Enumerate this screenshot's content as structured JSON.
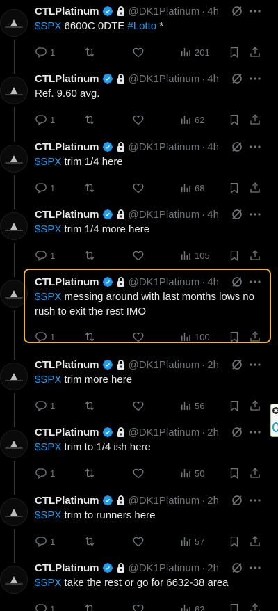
{
  "colors": {
    "background": "#000000",
    "text": "#e7e9ea",
    "muted": "#71767b",
    "link": "#1d9bf0",
    "verified": "#1d9bf0",
    "highlight": "#f2b630"
  },
  "icons": {
    "reply": "reply-icon",
    "repost": "repost-icon",
    "like": "like-icon",
    "views": "views-icon",
    "bookmark": "bookmark-icon",
    "share": "share-icon",
    "grok": "grok-icon",
    "more": "more-icon",
    "verified": "verified-badge-icon",
    "protected": "lock-icon"
  },
  "tweets": [
    {
      "display_name": "CTLPlatinum",
      "handle": "@DK1Platinum",
      "sep": "·",
      "time": "4h",
      "parts": [
        {
          "t": "$SPX",
          "c": "cashtag"
        },
        {
          "t": " 6600C 0DTE ",
          "c": ""
        },
        {
          "t": "#Lotto",
          "c": "hashtag"
        },
        {
          "t": " *",
          "c": ""
        }
      ],
      "replies": "1",
      "views": "201",
      "highlighted": false
    },
    {
      "display_name": "CTLPlatinum",
      "handle": "@DK1Platinum",
      "sep": "·",
      "time": "4h",
      "parts": [
        {
          "t": "Ref. 9.60 avg.",
          "c": ""
        }
      ],
      "replies": "1",
      "views": "62",
      "highlighted": false
    },
    {
      "display_name": "CTLPlatinum",
      "handle": "@DK1Platinum",
      "sep": "·",
      "time": "4h",
      "parts": [
        {
          "t": "$SPX",
          "c": "cashtag"
        },
        {
          "t": " trim 1/4 here",
          "c": ""
        }
      ],
      "replies": "1",
      "views": "68",
      "highlighted": false
    },
    {
      "display_name": "CTLPlatinum",
      "handle": "@DK1Platinum",
      "sep": "·",
      "time": "4h",
      "parts": [
        {
          "t": "$SPX",
          "c": "cashtag"
        },
        {
          "t": " trim 1/4 more here",
          "c": ""
        }
      ],
      "replies": "1",
      "views": "105",
      "highlighted": false
    },
    {
      "display_name": "CTLPlatinum",
      "handle": "@DK1Platinum",
      "sep": "·",
      "time": "4h",
      "parts": [
        {
          "t": "$SPX",
          "c": "cashtag"
        },
        {
          "t": " messing around with last months lows no rush to exit the rest IMO",
          "c": ""
        }
      ],
      "replies": "1",
      "views": "100",
      "highlighted": true
    },
    {
      "display_name": "CTLPlatinum",
      "handle": "@DK1Platinum",
      "sep": "·",
      "time": "2h",
      "parts": [
        {
          "t": "$SPX",
          "c": "cashtag"
        },
        {
          "t": " trim more here",
          "c": ""
        }
      ],
      "replies": "1",
      "views": "56",
      "highlighted": false
    },
    {
      "display_name": "CTLPlatinum",
      "handle": "@DK1Platinum",
      "sep": "·",
      "time": "2h",
      "parts": [
        {
          "t": "$SPX",
          "c": "cashtag"
        },
        {
          "t": " trim to 1/4 ish here",
          "c": ""
        }
      ],
      "replies": "1",
      "views": "50",
      "highlighted": false
    },
    {
      "display_name": "CTLPlatinum",
      "handle": "@DK1Platinum",
      "sep": "·",
      "time": "2h",
      "parts": [
        {
          "t": "$SPX",
          "c": "cashtag"
        },
        {
          "t": " trim to runners here",
          "c": ""
        }
      ],
      "replies": "1",
      "views": "57",
      "highlighted": false
    },
    {
      "display_name": "CTLPlatinum",
      "handle": "@DK1Platinum",
      "sep": "·",
      "time": "2h",
      "parts": [
        {
          "t": "$SPX",
          "c": "cashtag"
        },
        {
          "t": " take the rest or go for 6632-38 area",
          "c": ""
        }
      ],
      "replies": "1",
      "views": "62",
      "highlighted": false
    }
  ]
}
